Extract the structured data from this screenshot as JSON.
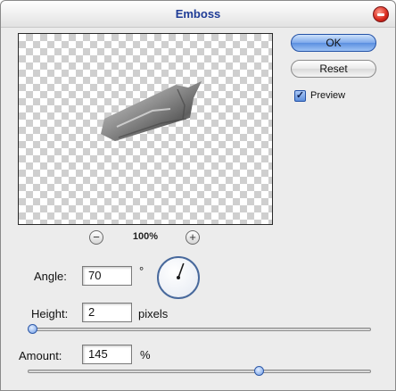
{
  "window": {
    "title": "Emboss",
    "close_icon": "close-icon"
  },
  "preview": {
    "zoom_level": "100%",
    "zoom_out_icon": "minus-icon",
    "zoom_in_icon": "plus-icon",
    "zoom_out_glyph": "−",
    "zoom_in_glyph": "+"
  },
  "buttons": {
    "ok_label": "OK",
    "reset_label": "Reset"
  },
  "preview_checkbox": {
    "checked": true,
    "label": "Preview",
    "check_glyph": "✓"
  },
  "angle": {
    "label": "Angle:",
    "value": "70",
    "unit": "°"
  },
  "height": {
    "label": "Height:",
    "value": "2",
    "unit": "pixels",
    "slider_fraction": 0.0
  },
  "amount": {
    "label": "Amount:",
    "value": "145",
    "unit": "%",
    "slider_fraction": 0.68
  },
  "colors": {
    "title_text": "#1f3c96",
    "ok_button": "#5b8fe0",
    "close_button": "#d8281c",
    "slider_thumb": "#6d9be6"
  }
}
